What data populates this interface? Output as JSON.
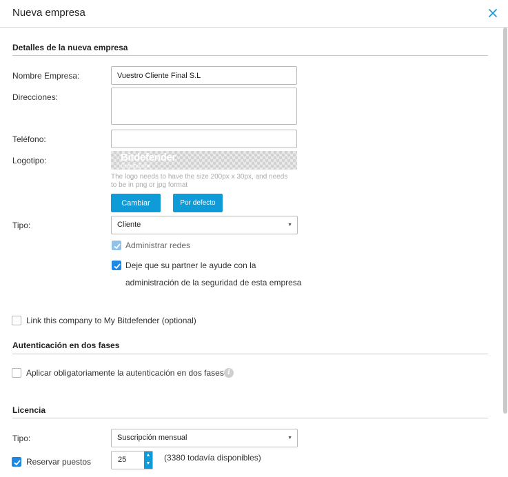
{
  "dialog": {
    "title": "Nueva empresa"
  },
  "details": {
    "section_title": "Detalles de la nueva empresa",
    "company_name_label": "Nombre Empresa:",
    "company_name_value": "Vuestro Cliente Final S.L",
    "addresses_label": "Direcciones:",
    "addresses_value": "",
    "phone_label": "Teléfono:",
    "phone_value": "",
    "logo_label": "Logotipo:",
    "logo_text": "Bitdefender",
    "logo_subtext": "GravityZone",
    "logo_hint": "The logo needs to have the size 200px x 30px, and needs to be in png or jpg format",
    "change_button": "Cambiar",
    "default_button": "Por defecto",
    "type_label": "Tipo:",
    "type_value": "Cliente",
    "manage_networks_label": "Administrar redes",
    "partner_help_line1": "Deje que su partner le ayude con la",
    "partner_help_line2": "administración de la seguridad de esta empresa",
    "link_company_label": "Link this company to My Bitdefender (optional)"
  },
  "two_factor": {
    "section_title": "Autenticación en dos fases",
    "enforce_label": "Aplicar obligatoriamente la autenticación en dos fases"
  },
  "license": {
    "section_title": "Licencia",
    "type_label": "Tipo:",
    "type_value": "Suscripción mensual",
    "reserve_label": "Reservar puestos",
    "reserve_value": "25",
    "available_text": "(3380 todavía disponibles)"
  },
  "colors": {
    "accent": "#0f9bd7",
    "checkbox_checked": "#1e88e5"
  },
  "icons": {
    "close": "close-icon",
    "info": "info-icon",
    "caret": "chevron-down-icon",
    "check": "check-icon"
  }
}
